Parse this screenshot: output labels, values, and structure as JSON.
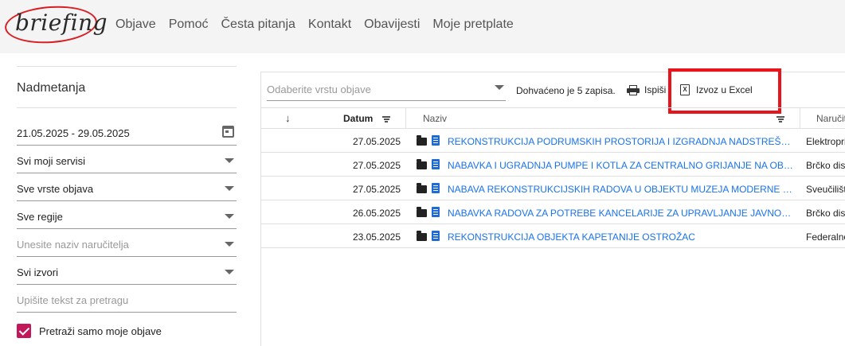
{
  "header": {
    "logo_text": "briefing",
    "nav": [
      "Objave",
      "Pomoć",
      "Česta pitanja",
      "Kontakt",
      "Obavijesti",
      "Moje pretplate"
    ]
  },
  "sidebar": {
    "title": "Nadmetanja",
    "date_range": "21.05.2025 - 29.05.2025",
    "services": "Svi moji servisi",
    "types": "Sve vrste objava",
    "regions": "Sve regije",
    "contractor_placeholder": "Unesite naziv naručitelja",
    "sources": "Svi izvori",
    "search_placeholder": "Upišite tekst za pretragu",
    "only_mine_label": "Pretraži samo moje objave",
    "only_mine_checked": true
  },
  "toolbar": {
    "type_select_placeholder": "Odaberite vrstu objave",
    "count_text": "Dohvaćeno je 5 zapisa.",
    "print_label": "Ispiši",
    "excel_label": "Izvoz u Excel",
    "excel_icon_letter": "X"
  },
  "table": {
    "sort_glyph": "↓",
    "columns": {
      "datum": "Datum",
      "naziv": "Naziv",
      "narucitelj": "Naručitelj"
    },
    "rows": [
      {
        "datum": "27.05.2025",
        "naziv": "REKONSTRUKCIJA PODRUMSKIH PROSTORIJA I IZGRADNJA NADSTREŠNICE",
        "narucitelj": "Elektroprivreda"
      },
      {
        "datum": "27.05.2025",
        "naziv": "NABAVKA I UGRADNJA PUMPE I KOTLA ZA CENTRALNO GRIJANJE NA OBJEKTU",
        "narucitelj": "Brčko distrikt"
      },
      {
        "datum": "27.05.2025",
        "naziv": "NABAVA REKONSTRUKCIJSKIH RADOVA U OBJEKTU MUZEJA MODERNE UMJETNOSTI",
        "narucitelj": "Sveučilište"
      },
      {
        "datum": "26.05.2025",
        "naziv": "NABAVKA RADOVA ZA POTREBE KANCELARIJE ZA UPRAVLJANJE JAVNOM IMOVINOM",
        "narucitelj": "Brčko distrikt"
      },
      {
        "datum": "23.05.2025",
        "naziv": "REKONSTRUKCIJA OBJEKTA KAPETANIJE OSTROŽAC",
        "narucitelj": "Federalno"
      }
    ]
  },
  "colors": {
    "accent": "#c2185b",
    "link": "#1a73e8",
    "highlight": "#e8141c",
    "logo_ring": "#d81e23"
  }
}
